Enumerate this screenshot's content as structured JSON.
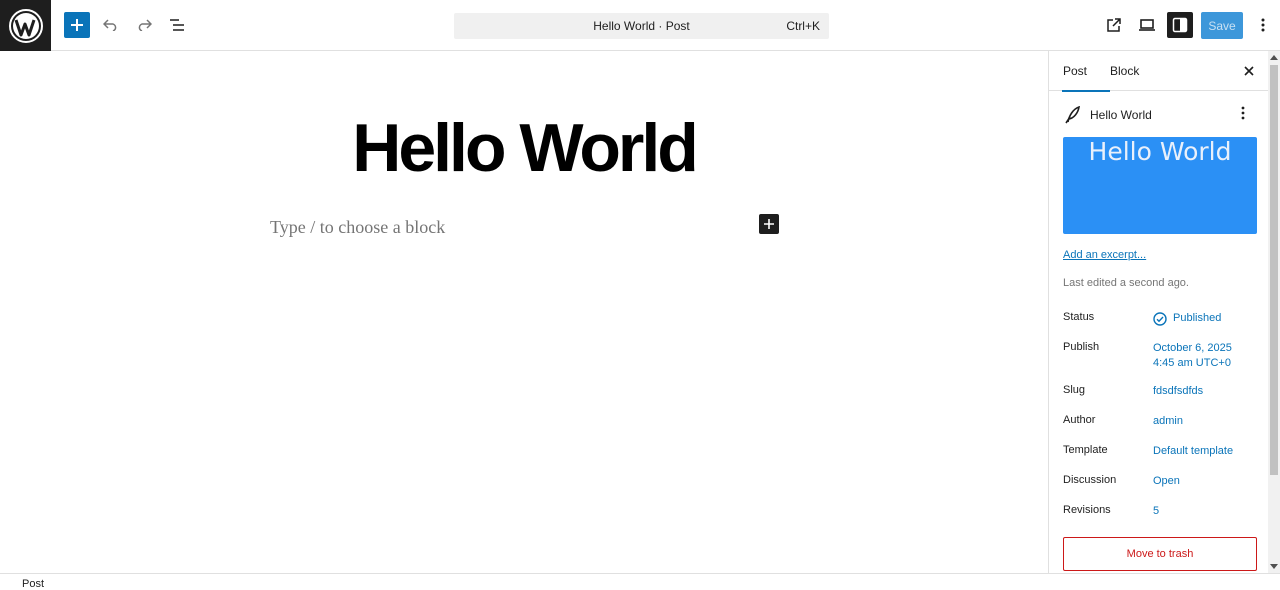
{
  "toolbar": {
    "save_label": "Save",
    "command_bar": {
      "title": "Hello World · Post",
      "shortcut": "Ctrl+K"
    }
  },
  "editor": {
    "title": "Hello World",
    "block_placeholder": "Type / to choose a block"
  },
  "sidebar": {
    "tabs": [
      {
        "label": "Post"
      },
      {
        "label": "Block"
      }
    ],
    "post_name": "Hello World",
    "featured_image_text": "Hello World",
    "excerpt_link": "Add an excerpt...",
    "last_edited": "Last edited a second ago.",
    "rows": {
      "status": {
        "label": "Status",
        "value": "Published"
      },
      "publish": {
        "label": "Publish",
        "value_line1": "October 6, 2025",
        "value_line2": "4:45 am UTC+0"
      },
      "slug": {
        "label": "Slug",
        "value": "fdsdfsdfds"
      },
      "author": {
        "label": "Author",
        "value": "admin"
      },
      "template": {
        "label": "Template",
        "value": "Default template"
      },
      "discussion": {
        "label": "Discussion",
        "value": "Open"
      },
      "revisions": {
        "label": "Revisions",
        "value": "5"
      }
    },
    "trash_label": "Move to trash"
  },
  "footer": {
    "breadcrumb": "Post"
  },
  "colors": {
    "accent": "#0a74b9",
    "danger": "#cc1818",
    "featured_bg": "#2b90f5",
    "dark": "#1e1e1e"
  }
}
